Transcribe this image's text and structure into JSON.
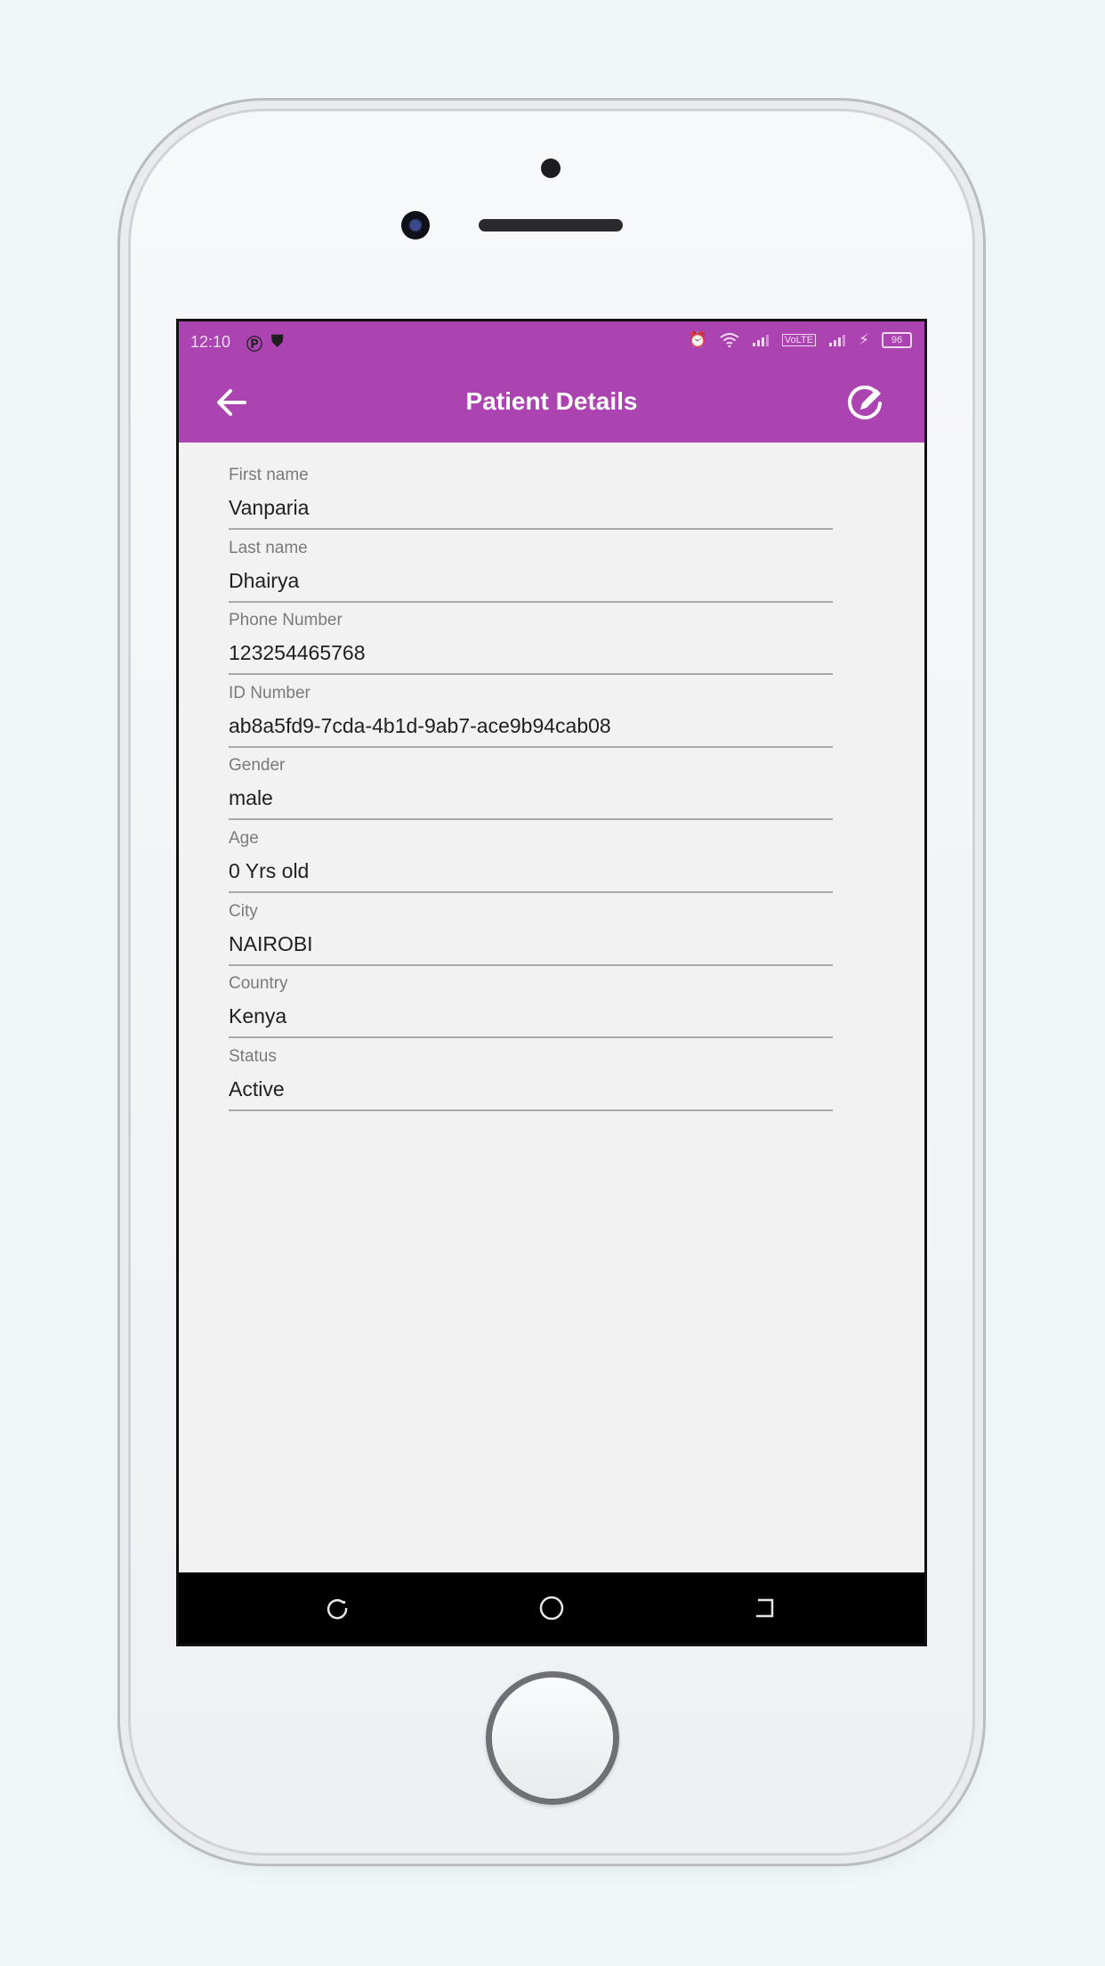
{
  "status_bar": {
    "time": "12:10",
    "left_icons": [
      "parking-icon",
      "shield-icon"
    ],
    "right_icons": [
      "alarm-icon",
      "wifi-icon",
      "signal-icon",
      "volte-icon",
      "signal-icon",
      "charging-icon"
    ],
    "volte_label": "VoLTE",
    "battery": "96"
  },
  "app_bar": {
    "title": "Patient Details",
    "back_icon": "arrow-left-icon",
    "edit_icon": "edit-icon"
  },
  "fields": [
    {
      "label": "First name",
      "value": "Vanparia"
    },
    {
      "label": "Last name",
      "value": "Dhairya"
    },
    {
      "label": "Phone Number",
      "value": "123254465768"
    },
    {
      "label": "ID Number",
      "value": "ab8a5fd9-7cda-4b1d-9ab7-ace9b94cab08"
    },
    {
      "label": "Gender",
      "value": "male"
    },
    {
      "label": "Age",
      "value": "0 Yrs old"
    },
    {
      "label": "City",
      "value": "NAIROBI"
    },
    {
      "label": "Country",
      "value": "Kenya"
    },
    {
      "label": "Status",
      "value": "Active"
    }
  ],
  "nav_bar": [
    "recent-apps-icon",
    "home-icon",
    "back-icon"
  ],
  "colors": {
    "accent": "#ab44b0",
    "background": "#f2f2f2",
    "underline": "#a9a9a9"
  }
}
